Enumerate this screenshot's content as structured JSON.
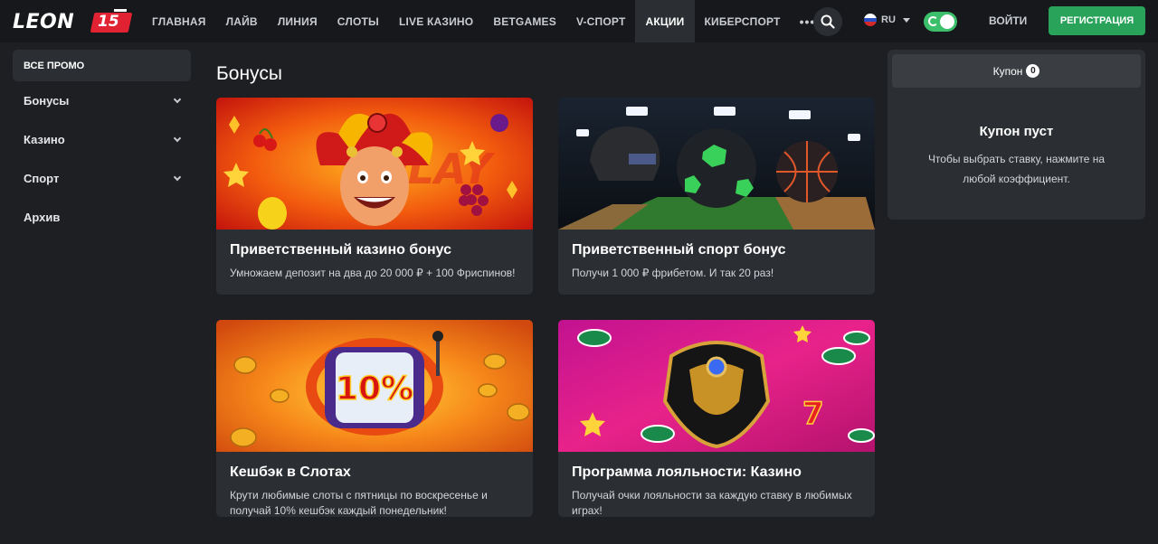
{
  "header": {
    "logo_text": "LEON",
    "logo_badge": "15",
    "nav": [
      "ГЛАВНАЯ",
      "ЛАЙВ",
      "ЛИНИЯ",
      "СЛОТЫ",
      "LIVE КАЗИНО",
      "BETGAMES",
      "V-СПОРТ",
      "АКЦИИ",
      "КИБЕРСПОРТ"
    ],
    "more": "•••",
    "lang": "RU",
    "login": "ВОЙТИ",
    "register": "РЕГИСТРАЦИЯ",
    "colors": {
      "register": "#29a35a",
      "toggle": "#3bbf6b",
      "logo_badge": "#e02232"
    }
  },
  "sidebar": {
    "all_promo": "ВСЕ ПРОМО",
    "items": [
      "Бонусы",
      "Казино",
      "Спорт",
      "Архив"
    ]
  },
  "main": {
    "title": "Бонусы",
    "cards": [
      {
        "title": "Приветственный казино бонус",
        "desc": "Умножаем депозит на два до 20 000 ₽ + 100 Фриспинов!",
        "image_text": "PLAY"
      },
      {
        "title": "Приветственный спорт бонус",
        "desc": "Получи 1 000 ₽ фрибетом. И так 20 раз!"
      },
      {
        "title": "Кешбэк в Слотах",
        "desc": "Крути любимые слоты с пятницы по воскресенье и получай 10% кешбэк каждый понедельник!",
        "image_text": "10%"
      },
      {
        "title": "Программа лояльности: Казино",
        "desc": "Получай очки лояльности за каждую ставку в любимых играх!",
        "image_text": "7"
      }
    ]
  },
  "coupon": {
    "tab_label": "Купон",
    "count": "0",
    "empty_title": "Купон пуст",
    "empty_text": "Чтобы выбрать ставку, нажмите на любой коэффициент."
  }
}
